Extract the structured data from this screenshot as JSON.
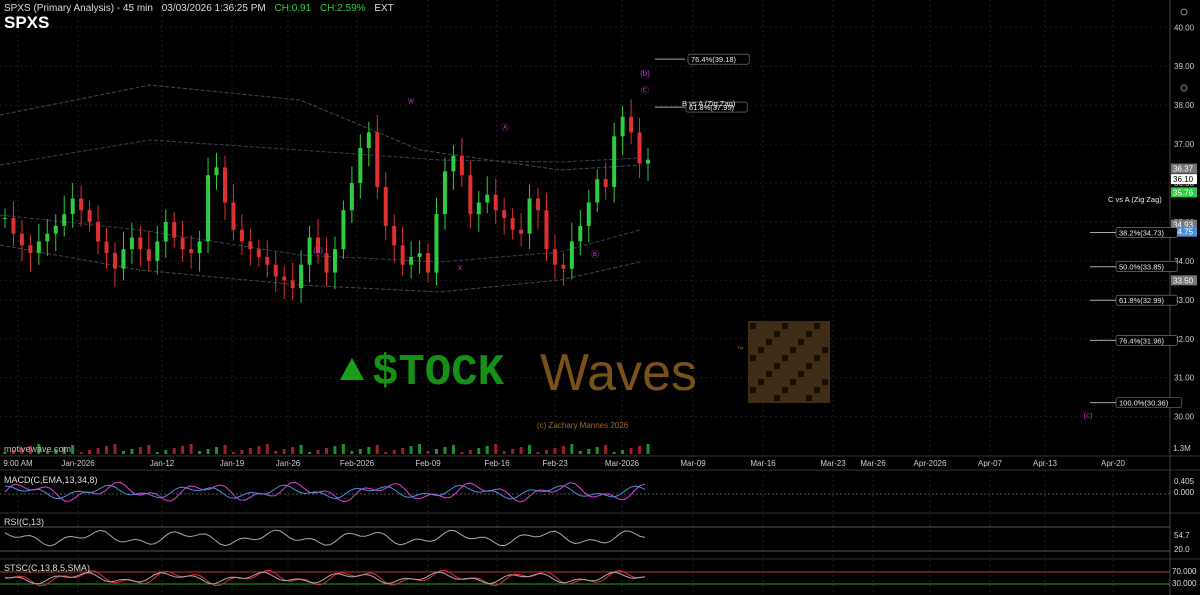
{
  "header": {
    "title": "SPXS (Primary Analysis) - 45 min",
    "datetime": "03/03/2026 1:36:25 PM",
    "change": "CH:0.91",
    "change_pct": "CH:2.59%",
    "session": "EXT",
    "symbol": "SPXS",
    "watermark": "motivewave.com"
  },
  "colors": {
    "up": "#2ecc40",
    "down": "#e03030",
    "wave": "#cc33cc",
    "bg": "#000000",
    "brand_green": "#1aa01a",
    "brand_gold": "#8a5a1c"
  },
  "chart_data": {
    "type": "candlestick",
    "ylim": [
      29.4,
      40.7
    ],
    "yticks": [
      "40.00",
      "39.00",
      "38.00",
      "37.00",
      "36.00",
      "35.00",
      "34.00",
      "33.50",
      "33.00",
      "32.00",
      "31.00",
      "30.00"
    ],
    "price_tags": [
      "36.37",
      "36.10",
      "35.76",
      "34.93",
      "34.75",
      "33.50"
    ],
    "volume_tag": "1.3M",
    "xticks": [
      "9:00 AM",
      "Jan-2026",
      "Jan-12",
      "Jan-19",
      "Jan-26",
      "Feb-2026",
      "Feb-09",
      "Feb-16",
      "Feb-23",
      "Mar-2026",
      "Mar-09",
      "Mar-16",
      "Mar-23",
      "Mar-26",
      "Apr-2026",
      "Apr-07",
      "Apr-13",
      "Apr-20"
    ],
    "wave_labels": [
      "(a)",
      "w",
      "x",
      "Ⓐ",
      "Ⓑ",
      "Ⓒ",
      "(b)",
      "(c)"
    ],
    "fib_levels": [
      {
        "label": "76.4%(39.18)",
        "value": 39.18
      },
      {
        "label": "61.8%(37.95)",
        "value": 37.95
      },
      {
        "label": "38.2%(34.73)",
        "value": 34.73
      },
      {
        "label": "50.0%(33.85)",
        "value": 33.85
      },
      {
        "label": "61.8%(32.99)",
        "value": 32.99
      },
      {
        "label": "76.4%(31.96)",
        "value": 31.96
      },
      {
        "label": "100.0%(30.36)",
        "value": 30.36
      }
    ],
    "annotations": [
      "B vs A (Zig Zag)",
      "C vs A (Zig Zag)"
    ],
    "closes": [
      35.1,
      34.7,
      34.4,
      34.2,
      34.5,
      34.7,
      34.9,
      35.2,
      35.6,
      35.3,
      35.0,
      34.5,
      34.2,
      33.8,
      34.3,
      34.6,
      34.3,
      34.0,
      34.5,
      35.0,
      34.6,
      34.3,
      34.2,
      34.5,
      36.2,
      36.4,
      35.5,
      34.8,
      34.5,
      34.3,
      34.1,
      33.9,
      33.6,
      33.5,
      33.3,
      33.9,
      34.6,
      34.2,
      33.7,
      34.3,
      35.3,
      36.0,
      36.9,
      37.3,
      35.9,
      34.9,
      34.4,
      33.9,
      34.1,
      34.2,
      33.7,
      35.2,
      36.3,
      36.7,
      36.2,
      35.2,
      35.5,
      35.7,
      35.3,
      35.1,
      34.8,
      34.7,
      35.6,
      35.3,
      34.3,
      33.9,
      33.8,
      34.5,
      34.9,
      35.5,
      36.1,
      35.9,
      37.2,
      37.7,
      37.3,
      36.5,
      36.6
    ]
  },
  "indicators": {
    "macd": {
      "label": "MACD(C,EMA,13,34,8)",
      "tags": [
        "0.405",
        "0.000"
      ]
    },
    "rsi": {
      "label": "RSI(C,13)",
      "tags": [
        "54.7",
        "20.0"
      ]
    },
    "stoch": {
      "label": "STSC(C,13,8,5,SMA)",
      "tags": [
        "70.000",
        "30.000"
      ]
    }
  },
  "brand": {
    "stock": "$TOCK",
    "waves": "Waves",
    "tm": "™",
    "copyright": "(c) Zachary Mannes 2026"
  }
}
